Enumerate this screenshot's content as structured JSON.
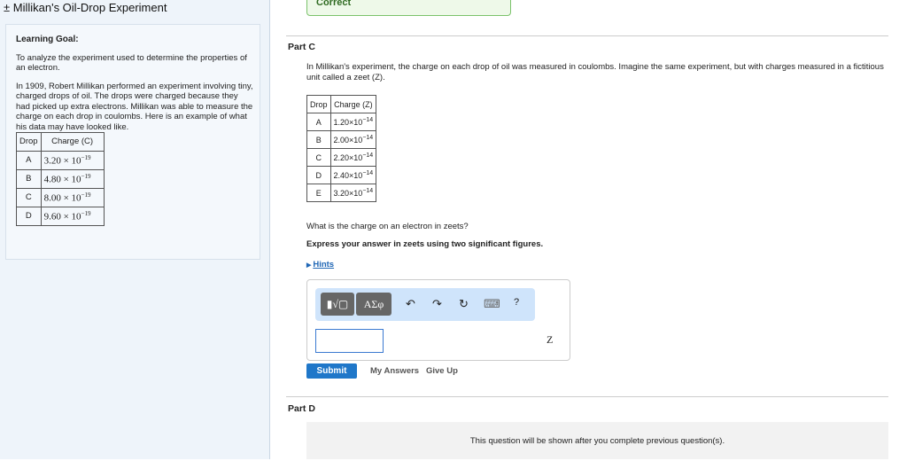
{
  "title": "± Millikan's Oil-Drop Experiment",
  "goal": {
    "heading": "Learning Goal:",
    "p1": "To analyze the experiment used to determine the properties of an electron.",
    "p2": "In 1909, Robert Millikan performed an experiment involving tiny, charged drops of oil. The drops were charged because they had picked up extra electrons. Millikan was able to measure the charge on each drop in coulombs. Here is an example of what his data may have looked like.",
    "table": {
      "h1": "Drop",
      "h2": "Charge (C)",
      "rows": [
        {
          "d": "A",
          "m": "3.20 × 10",
          "e": "−19"
        },
        {
          "d": "B",
          "m": "4.80 × 10",
          "e": "−19"
        },
        {
          "d": "C",
          "m": "8.00 × 10",
          "e": "−19"
        },
        {
          "d": "D",
          "m": "9.60 × 10",
          "e": "−19"
        }
      ]
    }
  },
  "correct": "Correct",
  "partC": {
    "label": "Part C",
    "intro": "In Millikan's experiment, the charge on each drop of oil was measured in coulombs. Imagine the same experiment, but with charges measured in a fictitious unit called a zeet (Z).",
    "table": {
      "h1": "Drop",
      "h2": "Charge (Z)",
      "rows": [
        {
          "d": "A",
          "m": "1.20×10",
          "e": "−14"
        },
        {
          "d": "B",
          "m": "2.00×10",
          "e": "−14"
        },
        {
          "d": "C",
          "m": "2.20×10",
          "e": "−14"
        },
        {
          "d": "D",
          "m": "2.40×10",
          "e": "−14"
        },
        {
          "d": "E",
          "m": "3.20×10",
          "e": "−14"
        }
      ]
    },
    "question": "What is the charge on an electron in zeets?",
    "instruction": "Express your answer in zeets using two significant figures.",
    "hints": "Hints",
    "toolbar": {
      "templates": "▮√▢",
      "greek": "ΑΣφ",
      "undo": "↶",
      "redo": "↷",
      "reset": "↻",
      "keyboard": "⌨",
      "help": "?"
    },
    "answer_value": "",
    "unit": "Z",
    "submit": "Submit",
    "my_answers": "My Answers",
    "give_up": "Give Up"
  },
  "partD": {
    "label": "Part D",
    "locked": "This question will be shown after you complete previous question(s)."
  }
}
